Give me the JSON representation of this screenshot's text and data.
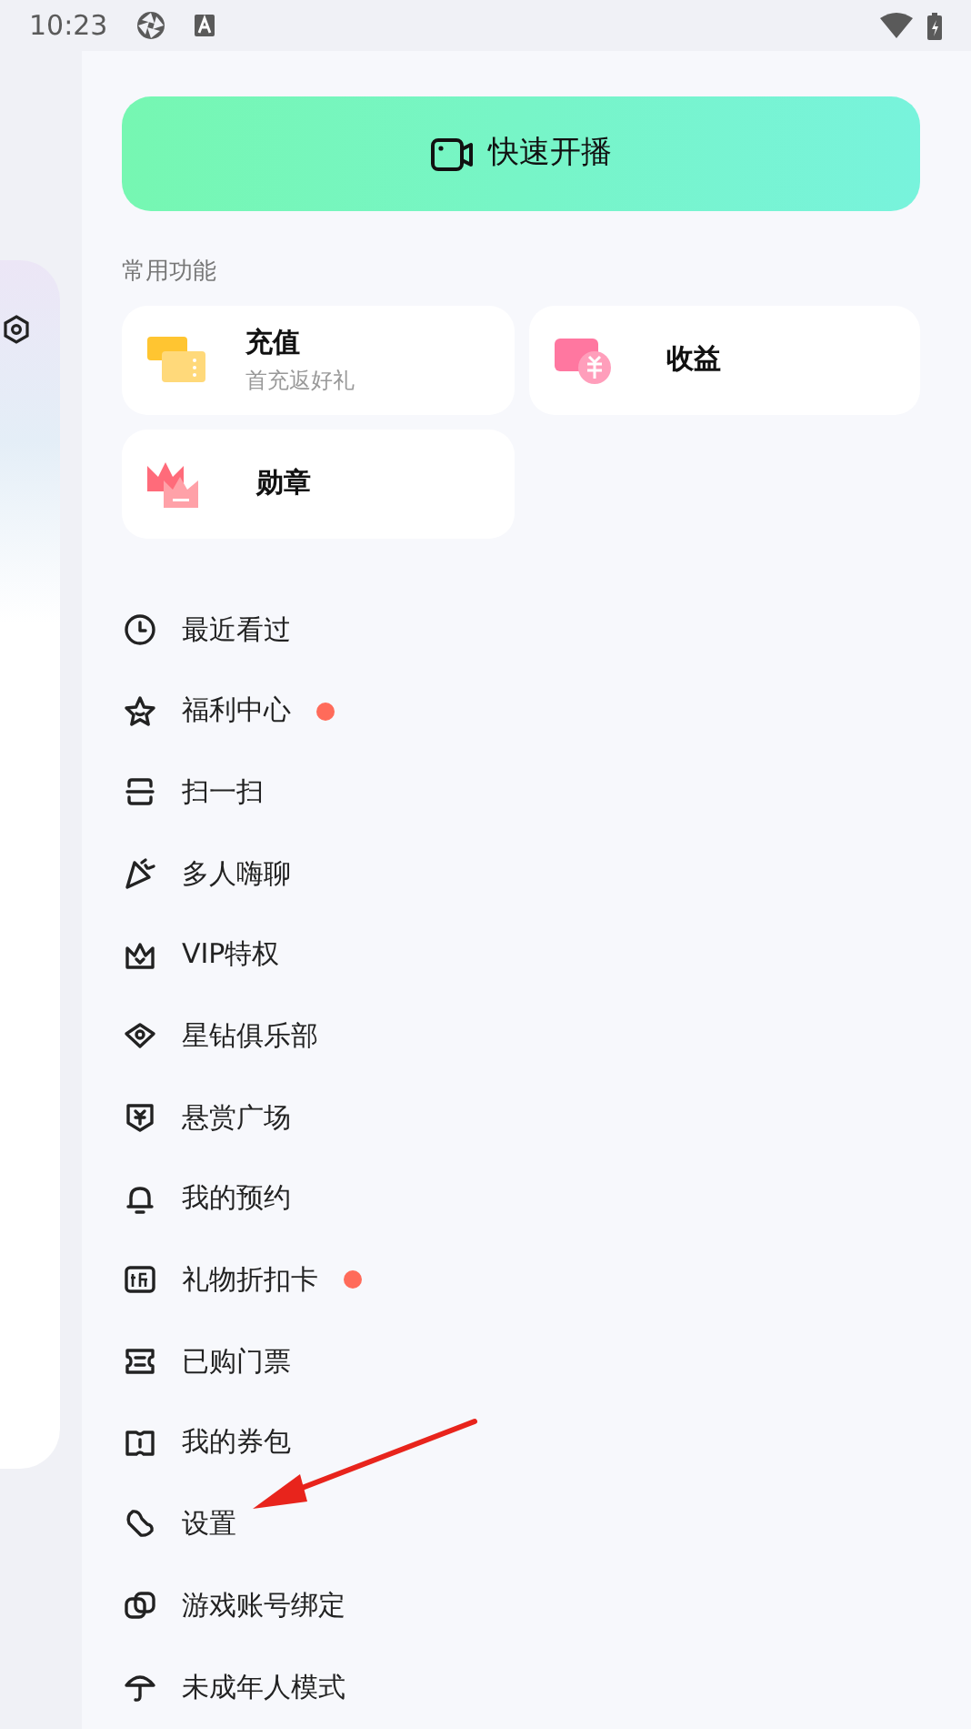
{
  "status_bar": {
    "time": "10:23"
  },
  "live_button": {
    "label": "快速开播"
  },
  "common_section": {
    "title": "常用功能",
    "cards": [
      {
        "title": "充值",
        "subtitle": "首充返好礼"
      },
      {
        "title": "收益"
      },
      {
        "title": "勋章"
      }
    ]
  },
  "menu": [
    {
      "label": "最近看过",
      "badge": false
    },
    {
      "label": "福利中心",
      "badge": true
    },
    {
      "label": "扫一扫",
      "badge": false
    },
    {
      "label": "多人嗨聊",
      "badge": false
    },
    {
      "label": "VIP特权",
      "badge": false
    },
    {
      "label": "星钻俱乐部",
      "badge": false
    },
    {
      "label": "悬赏广场",
      "badge": false
    },
    {
      "label": "我的预约",
      "badge": false
    },
    {
      "label": "礼物折扣卡",
      "badge": true
    },
    {
      "label": "已购门票",
      "badge": false
    },
    {
      "label": "我的券包",
      "badge": false
    },
    {
      "label": "设置",
      "badge": false
    },
    {
      "label": "游戏账号绑定",
      "badge": false
    },
    {
      "label": "未成年人模式",
      "badge": false
    }
  ]
}
